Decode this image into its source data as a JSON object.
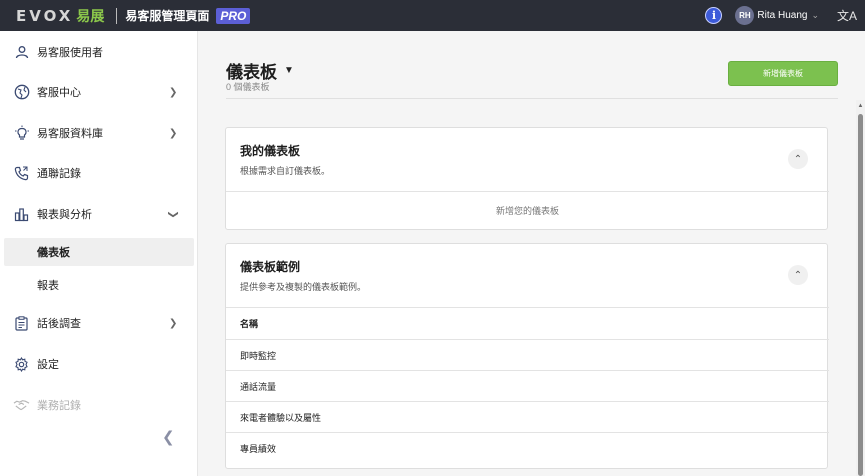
{
  "topbar": {
    "logo_text": "EVOX",
    "logo_cn": "易展",
    "app_title": "易客服管理頁面",
    "pro_badge": "PRO",
    "info_icon": "info-icon",
    "user_initials": "RH",
    "user_name": "Rita Huang",
    "language_icon": "translate-icon"
  },
  "sidebar": {
    "items": [
      {
        "label": "易客服使用者",
        "icon": "user-icon"
      },
      {
        "label": "客服中心",
        "icon": "globe-icon"
      },
      {
        "label": "易客服資料庫",
        "icon": "lightbulb-icon"
      },
      {
        "label": "通聯記錄",
        "icon": "phone-icon"
      },
      {
        "label": "報表與分析",
        "icon": "bar-chart-icon"
      },
      {
        "label": "話後調查",
        "icon": "clipboard-icon"
      },
      {
        "label": "設定",
        "icon": "gear-icon"
      },
      {
        "label": "業務記錄",
        "icon": "handshake-icon"
      }
    ],
    "sub_items": [
      {
        "label": "儀表板",
        "active": true
      },
      {
        "label": "報表",
        "active": false
      }
    ]
  },
  "main": {
    "title": "儀表板",
    "subtitle": "0 個儀表板",
    "add_button": "新增儀表板",
    "my_dashboards": {
      "title": "我的儀表板",
      "description": "根據需求自訂儀表板。",
      "empty_text": "新增您的儀表板"
    },
    "examples": {
      "title": "儀表板範例",
      "description": "提供參考及複製的儀表板範例。",
      "column_header": "名稱",
      "rows": [
        "即時監控",
        "通話流量",
        "來電者體驗以及屬性",
        "專員績效"
      ]
    }
  },
  "colors": {
    "topbar": "#2b2e37",
    "accent_green": "#7cc14f",
    "pro_badge": "#5c5fd6",
    "info_blue": "#3d5bd9"
  }
}
